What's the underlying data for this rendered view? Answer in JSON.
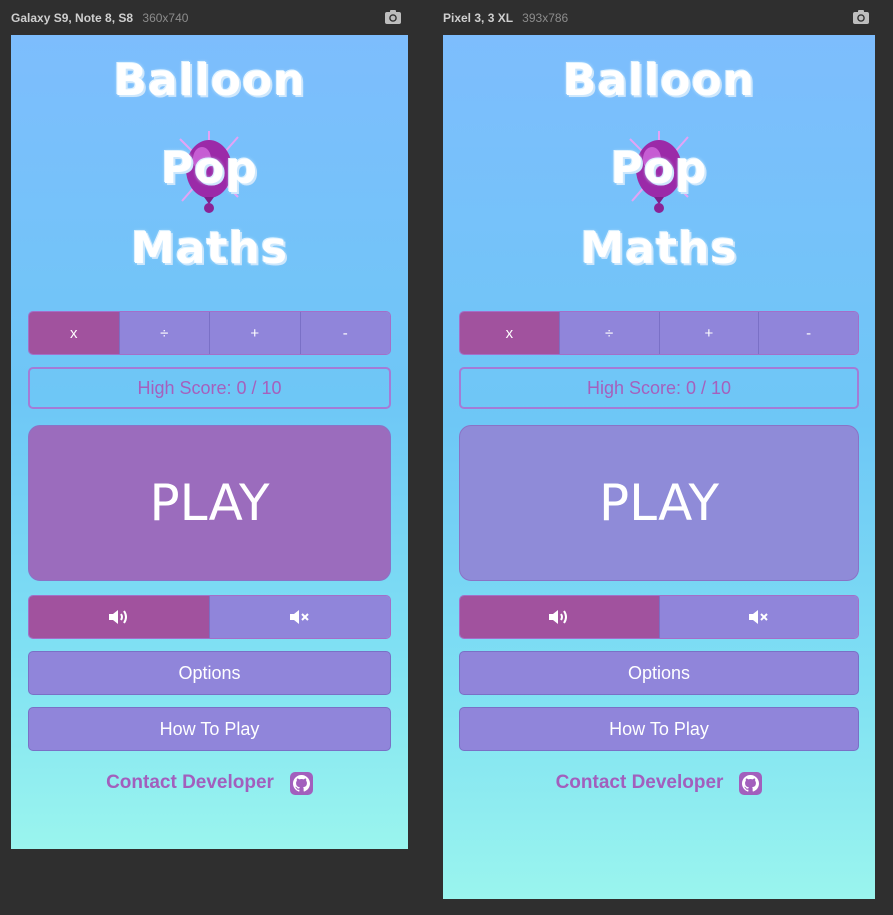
{
  "devices": [
    {
      "name": "Galaxy S9, Note 8, S8",
      "size": "360x740",
      "play_color": "#9b6cbd"
    },
    {
      "name": "Pixel 3, 3 XL",
      "size": "393x786",
      "play_color": "#8f8bd8"
    }
  ],
  "app": {
    "title_line1": "Balloon",
    "title_line2": "Pop",
    "title_line3": "Maths",
    "operations": [
      "x",
      "÷",
      "+",
      "-"
    ],
    "selected_operation": "x",
    "high_score": "High Score: 0 / 10",
    "play_label": "PLAY",
    "sound_on_icon": "volume-up-icon",
    "sound_off_icon": "volume-mute-icon",
    "sound_selected": "on",
    "options_label": "Options",
    "how_to_play_label": "How To Play",
    "contact_label": "Contact Developer",
    "contact_icon": "github-icon"
  },
  "colors": {
    "active": "#a1529e",
    "inactive": "#9085da",
    "accent_text": "#a25fbd"
  }
}
